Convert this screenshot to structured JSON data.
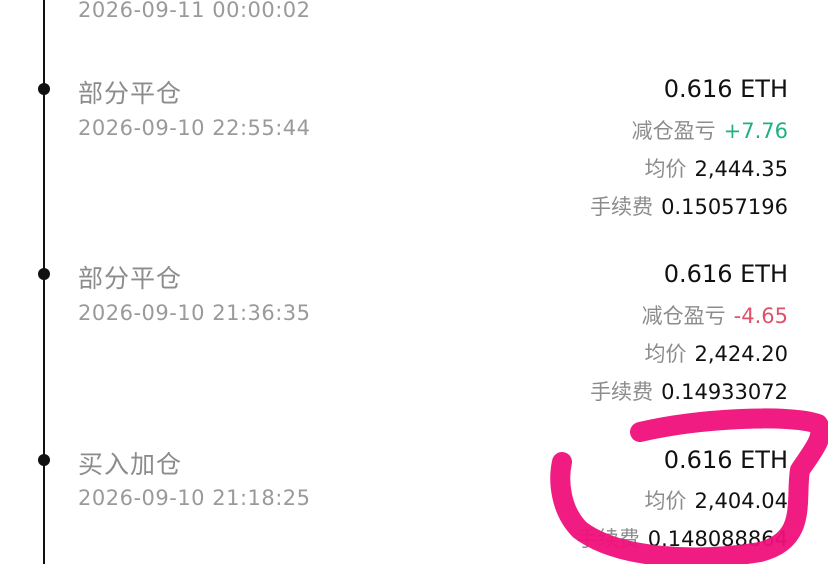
{
  "timeline": {
    "top_partial_time": "2026-09-11 00:00:02",
    "entries": [
      {
        "title": "部分平仓",
        "time": "2026-09-10 22:55:44",
        "amount": "0.616 ETH",
        "pnl_label": "减仓盈亏",
        "pnl_value": "+7.76",
        "avg_label": "均价",
        "avg_value": "2,444.35",
        "fee_label": "手续费",
        "fee_value": "0.15057196"
      },
      {
        "title": "部分平仓",
        "time": "2026-09-10 21:36:35",
        "amount": "0.616 ETH",
        "pnl_label": "减仓盈亏",
        "pnl_value": "-4.65",
        "avg_label": "均价",
        "avg_value": "2,424.20",
        "fee_label": "手续费",
        "fee_value": "0.14933072"
      },
      {
        "title": "买入加仓",
        "time": "2026-09-10 21:18:25",
        "amount": "0.616 ETH",
        "avg_label": "均价",
        "avg_value": "2,404.04",
        "fee_label": "手续费",
        "fee_value": "0.148088864"
      }
    ]
  },
  "colors": {
    "positive": "#22b07d",
    "negative": "#e0506a",
    "annotation": "#f0107a"
  }
}
